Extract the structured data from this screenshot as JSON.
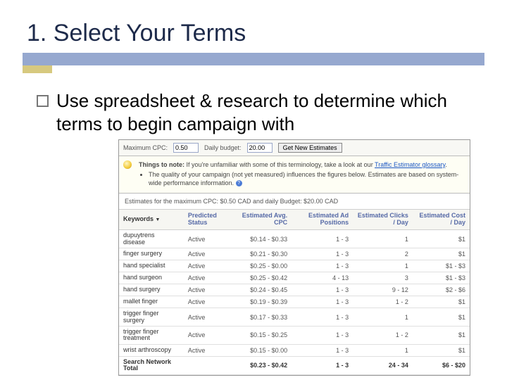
{
  "slide": {
    "title": "1.  Select Your Terms",
    "body": "Use spreadsheet & research to determine which terms to begin campaign with"
  },
  "tool": {
    "maxCpcLabel": "Maximum CPC:",
    "maxCpcValue": "0.50",
    "budgetLabel": "Daily budget:",
    "budgetValue": "20.00",
    "button": "Get New Estimates",
    "noteHeading": "Things to note:",
    "noteLine1a": "If you're unfamiliar with some of this terminology, take a look at our ",
    "noteLink": "Traffic Estimator glossary",
    "noteLine1b": ".",
    "noteLine2": "The quality of your campaign (not yet measured) influences the figures below. Estimates are based on system-wide performance information.",
    "infoGlyph": "?",
    "estimatesLine": "Estimates for the maximum CPC: $0.50 CAD and daily Budget: $20.00 CAD"
  },
  "table": {
    "headers": {
      "kw": "Keywords",
      "sort": "▼",
      "status": "Predicted Status",
      "avgcpc": "Estimated Avg. CPC",
      "pos": "Estimated Ad Positions",
      "clicks": "Estimated Clicks / Day",
      "cost": "Estimated Cost / Day"
    },
    "rows": [
      {
        "kw": "dupuytrens disease",
        "status": "Active",
        "avgcpc": "$0.14 - $0.33",
        "pos": "1 - 3",
        "clicks": "1",
        "cost": "$1"
      },
      {
        "kw": "finger surgery",
        "status": "Active",
        "avgcpc": "$0.21 - $0.30",
        "pos": "1 - 3",
        "clicks": "2",
        "cost": "$1"
      },
      {
        "kw": "hand specialist",
        "status": "Active",
        "avgcpc": "$0.25 - $0.00",
        "pos": "1 - 3",
        "clicks": "1",
        "cost": "$1 - $3"
      },
      {
        "kw": "hand surgeon",
        "status": "Active",
        "avgcpc": "$0.25 - $0.42",
        "pos": "4 - 13",
        "clicks": "3",
        "cost": "$1 - $3"
      },
      {
        "kw": "hand surgery",
        "status": "Active",
        "avgcpc": "$0.24 - $0.45",
        "pos": "1 - 3",
        "clicks": "9 - 12",
        "cost": "$2 - $6"
      },
      {
        "kw": "mallet finger",
        "status": "Active",
        "avgcpc": "$0.19 - $0.39",
        "pos": "1 - 3",
        "clicks": "1 - 2",
        "cost": "$1"
      },
      {
        "kw": "trigger finger surgery",
        "status": "Active",
        "avgcpc": "$0.17 - $0.33",
        "pos": "1 - 3",
        "clicks": "1",
        "cost": "$1"
      },
      {
        "kw": "trigger finger treatment",
        "status": "Active",
        "avgcpc": "$0.15 - $0.25",
        "pos": "1 - 3",
        "clicks": "1 - 2",
        "cost": "$1"
      },
      {
        "kw": "wrist arthroscopy",
        "status": "Active",
        "avgcpc": "$0.15 - $0.00",
        "pos": "1 - 3",
        "clicks": "1",
        "cost": "$1"
      }
    ],
    "total": {
      "kw": "Search Network Total",
      "status": "",
      "avgcpc": "$0.23 - $0.42",
      "pos": "1 - 3",
      "clicks": "24 - 34",
      "cost": "$6 - $20"
    }
  }
}
